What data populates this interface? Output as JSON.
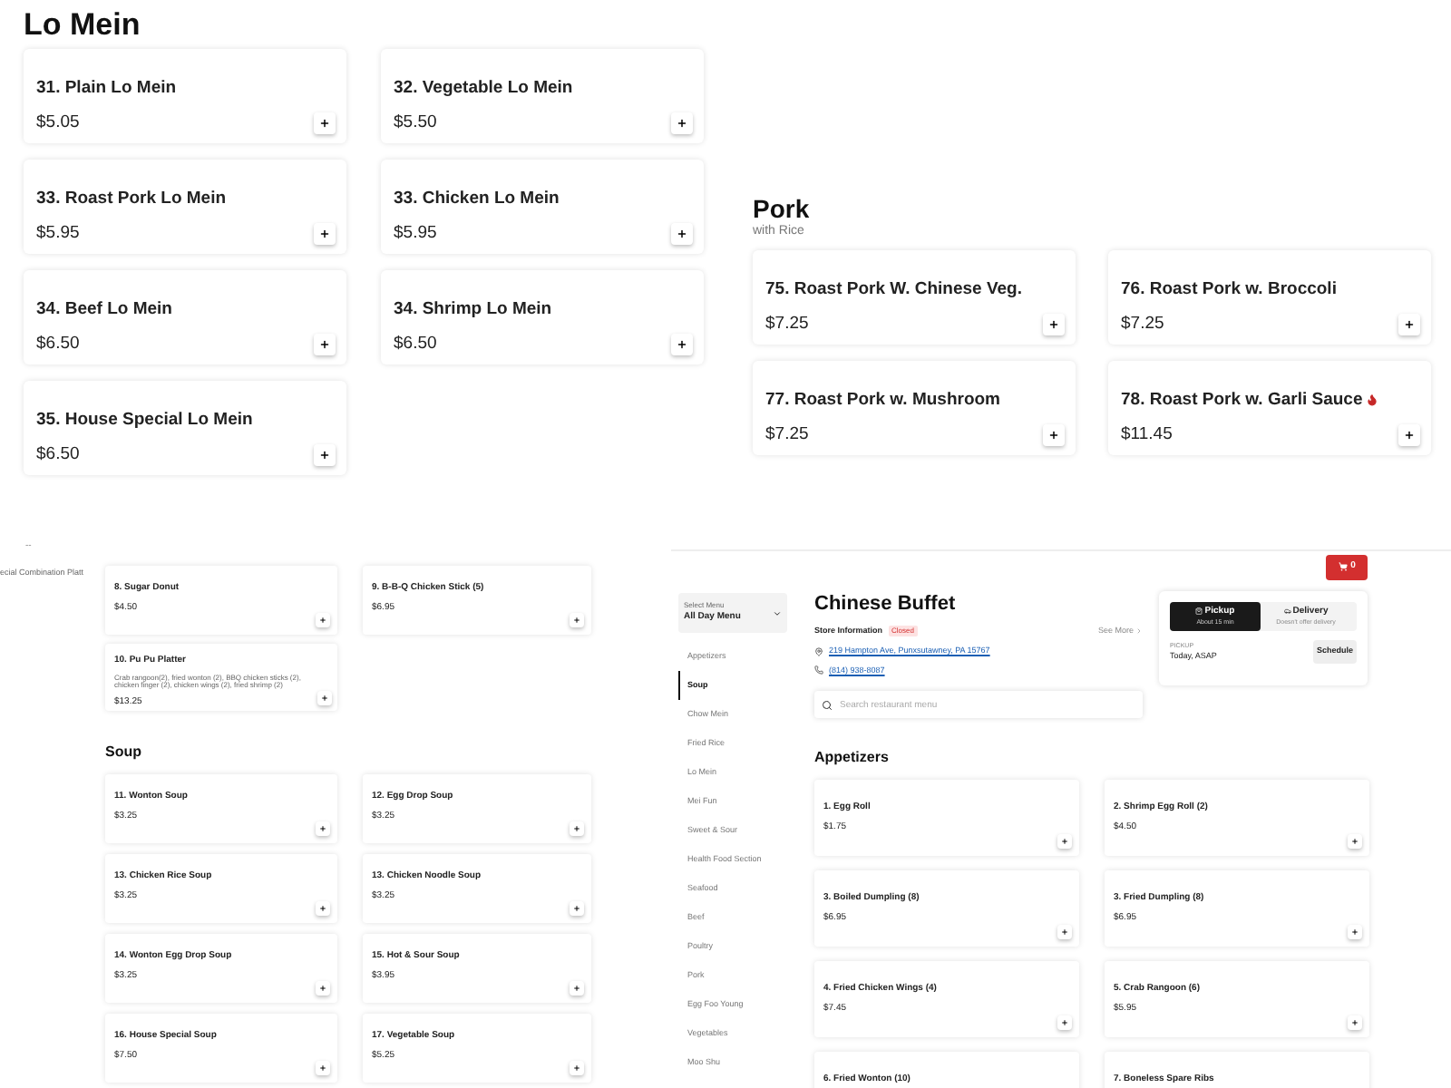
{
  "lo_mein": {
    "title": "Lo Mein",
    "items": [
      {
        "name": "31. Plain Lo Mein",
        "price": "$5.05"
      },
      {
        "name": "32. Vegetable Lo Mein",
        "price": "$5.50"
      },
      {
        "name": "33. Roast Pork Lo Mein",
        "price": "$5.95"
      },
      {
        "name": "33. Chicken Lo Mein",
        "price": "$5.95"
      },
      {
        "name": "34. Beef Lo Mein",
        "price": "$6.50"
      },
      {
        "name": "34. Shrimp Lo Mein",
        "price": "$6.50"
      },
      {
        "name": "35. House Special Lo Mein",
        "price": "$6.50"
      }
    ]
  },
  "pork": {
    "title": "Pork",
    "subtitle": "with Rice",
    "items": [
      {
        "name": "75. Roast Pork W. Chinese Veg.",
        "price": "$7.25",
        "spicy": false
      },
      {
        "name": "76. Roast Pork w. Broccoli",
        "price": "$7.25",
        "spicy": false
      },
      {
        "name": "77. Roast Pork w. Mushroom",
        "price": "$7.25",
        "spicy": false
      },
      {
        "name": "78. Roast Pork w. Garli Sauce",
        "price": "$11.45",
        "spicy": true
      }
    ]
  },
  "combination_panel": {
    "top_mark": "--",
    "sidebar_item": "ecial Combination Platt",
    "items": [
      {
        "name": "8. Sugar Donut",
        "price": "$4.50"
      },
      {
        "name": "9. B-B-Q Chicken Stick (5)",
        "price": "$6.95"
      },
      {
        "name": "10. Pu Pu Platter",
        "description": "Crab rangoon(2), fried wonton (2), BBQ chicken sticks (2), chicken finger (2), chicken wings (2), fried shrimp (2)",
        "price": "$13.25"
      }
    ],
    "soup": {
      "title": "Soup",
      "items": [
        {
          "name": "11. Wonton Soup",
          "price": "$3.25"
        },
        {
          "name": "12. Egg Drop Soup",
          "price": "$3.25"
        },
        {
          "name": "13. Chicken Rice Soup",
          "price": "$3.25"
        },
        {
          "name": "13. Chicken Noodle Soup",
          "price": "$3.25"
        },
        {
          "name": "14. Wonton Egg Drop Soup",
          "price": "$3.25"
        },
        {
          "name": "15. Hot & Sour Soup",
          "price": "$3.95"
        },
        {
          "name": "16. House Special Soup",
          "price": "$7.50"
        },
        {
          "name": "17. Vegetable Soup",
          "price": "$5.25"
        }
      ]
    }
  },
  "restaurant": {
    "cart": {
      "count": "0"
    },
    "menu_select": {
      "label": "Select Menu",
      "value": "All Day Menu"
    },
    "categories": [
      {
        "label": "Appetizers",
        "selected": false
      },
      {
        "label": "Soup",
        "selected": true
      },
      {
        "label": "Chow Mein",
        "selected": false
      },
      {
        "label": "Fried Rice",
        "selected": false
      },
      {
        "label": "Lo Mein",
        "selected": false
      },
      {
        "label": "Mei Fun",
        "selected": false
      },
      {
        "label": "Sweet & Sour",
        "selected": false
      },
      {
        "label": "Health Food Section",
        "selected": false
      },
      {
        "label": "Seafood",
        "selected": false
      },
      {
        "label": "Beef",
        "selected": false
      },
      {
        "label": "Poultry",
        "selected": false
      },
      {
        "label": "Pork",
        "selected": false
      },
      {
        "label": "Egg Foo Young",
        "selected": false
      },
      {
        "label": "Vegetables",
        "selected": false
      },
      {
        "label": "Moo Shu",
        "selected": false
      }
    ],
    "name": "Chinese Buffet",
    "store_info": {
      "label": "Store Information",
      "status": "Closed",
      "see_more": "See More",
      "address": "219 Hampton Ave, Punxsutawney, PA 15767",
      "phone": "(814) 938-8087"
    },
    "search": {
      "placeholder": "Search restaurant menu"
    },
    "order_mode": {
      "options": [
        {
          "kind": "pickup",
          "label": "Pickup",
          "sub": "About 15 min",
          "selected": true
        },
        {
          "kind": "delivery",
          "label": "Delivery",
          "sub": "Doesn't offer delivery",
          "selected": false
        }
      ],
      "time_label": "PICKUP",
      "time_value": "Today, ASAP",
      "schedule": "Schedule"
    },
    "section": {
      "title": "Appetizers",
      "items": [
        {
          "name": "1. Egg Roll",
          "price": "$1.75"
        },
        {
          "name": "2. Shrimp Egg Roll (2)",
          "price": "$4.50"
        },
        {
          "name": "3. Boiled Dumpling (8)",
          "price": "$6.95"
        },
        {
          "name": "3. Fried Dumpling (8)",
          "price": "$6.95"
        },
        {
          "name": "4. Fried Chicken Wings (4)",
          "price": "$7.45"
        },
        {
          "name": "5. Crab Rangoon (6)",
          "price": "$5.95"
        },
        {
          "name": "6. Fried Wonton (10)"
        },
        {
          "name": "7. Boneless Spare Ribs"
        }
      ]
    }
  }
}
